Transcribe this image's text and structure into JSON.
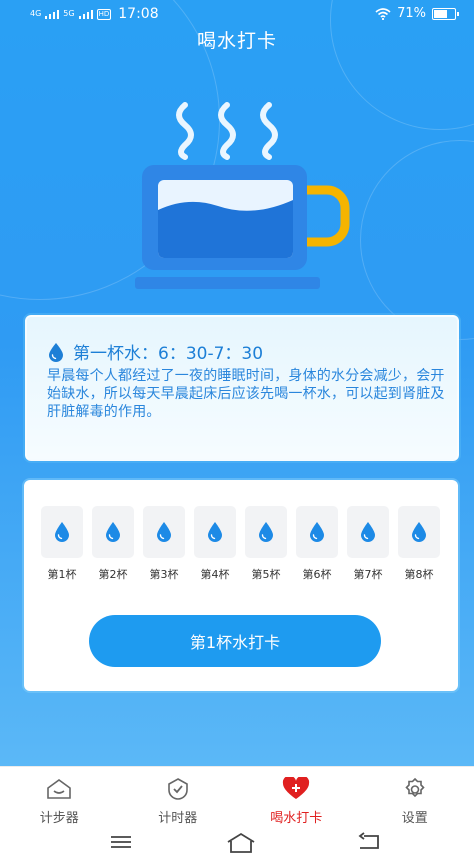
{
  "status_bar": {
    "network_1": "4G",
    "network_2": "5G",
    "hd": "HD",
    "time": "17:08",
    "battery_text": "71%",
    "battery_level": 0.71
  },
  "header": {
    "title": "喝水打卡"
  },
  "tip": {
    "title": "第一杯水：6：30-7：30",
    "body": "早晨每个人都经过了一夜的睡眠时间，身体的水分会减少，会开始缺水，所以每天早晨起床后应该先喝一杯水，可以起到肾脏及肝脏解毒的作用。"
  },
  "cups": [
    {
      "label": "第1杯"
    },
    {
      "label": "第2杯"
    },
    {
      "label": "第3杯"
    },
    {
      "label": "第4杯"
    },
    {
      "label": "第5杯"
    },
    {
      "label": "第6杯"
    },
    {
      "label": "第7杯"
    },
    {
      "label": "第8杯"
    }
  ],
  "checkin_button": {
    "label": "第1杯水打卡"
  },
  "tabs": [
    {
      "label": "计步器",
      "icon": "home-face-icon",
      "active": false
    },
    {
      "label": "计时器",
      "icon": "check-shield-icon",
      "active": false
    },
    {
      "label": "喝水打卡",
      "icon": "heart-plus-icon",
      "active": true
    },
    {
      "label": "设置",
      "icon": "gear-icon",
      "active": false
    }
  ],
  "colors": {
    "primary_blue": "#1e9bf0",
    "accent_red": "#e02020",
    "mug_handle": "#f5b400"
  }
}
